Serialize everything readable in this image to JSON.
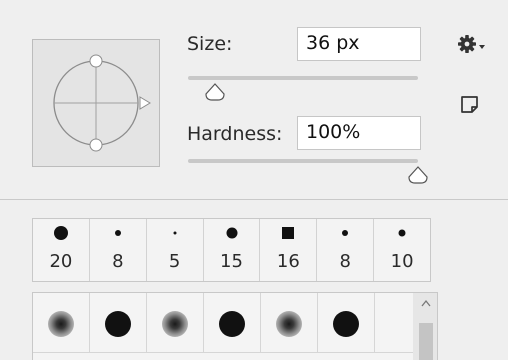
{
  "size": {
    "label": "Size:",
    "value": "36 px",
    "slider_fraction": 0.09
  },
  "hardness": {
    "label": "Hardness:",
    "value": "100%",
    "slider_fraction": 1.0
  },
  "icons": {
    "settings": "gear-icon",
    "new_preset": "new-preset-icon",
    "tip_preview": "brush-tip-preview"
  },
  "recent_brushes": [
    {
      "size": "20",
      "shape": "round",
      "dot": 14
    },
    {
      "size": "8",
      "shape": "round",
      "dot": 6
    },
    {
      "size": "5",
      "shape": "round",
      "dot": 3
    },
    {
      "size": "15",
      "shape": "round",
      "dot": 11
    },
    {
      "size": "16",
      "shape": "square",
      "dot": 12
    },
    {
      "size": "8",
      "shape": "round",
      "dot": 6
    },
    {
      "size": "10",
      "shape": "round",
      "dot": 7
    }
  ],
  "presets_row": [
    {
      "kind": "soft"
    },
    {
      "kind": "hard"
    },
    {
      "kind": "soft"
    },
    {
      "kind": "hard"
    },
    {
      "kind": "soft"
    },
    {
      "kind": "hard"
    }
  ]
}
